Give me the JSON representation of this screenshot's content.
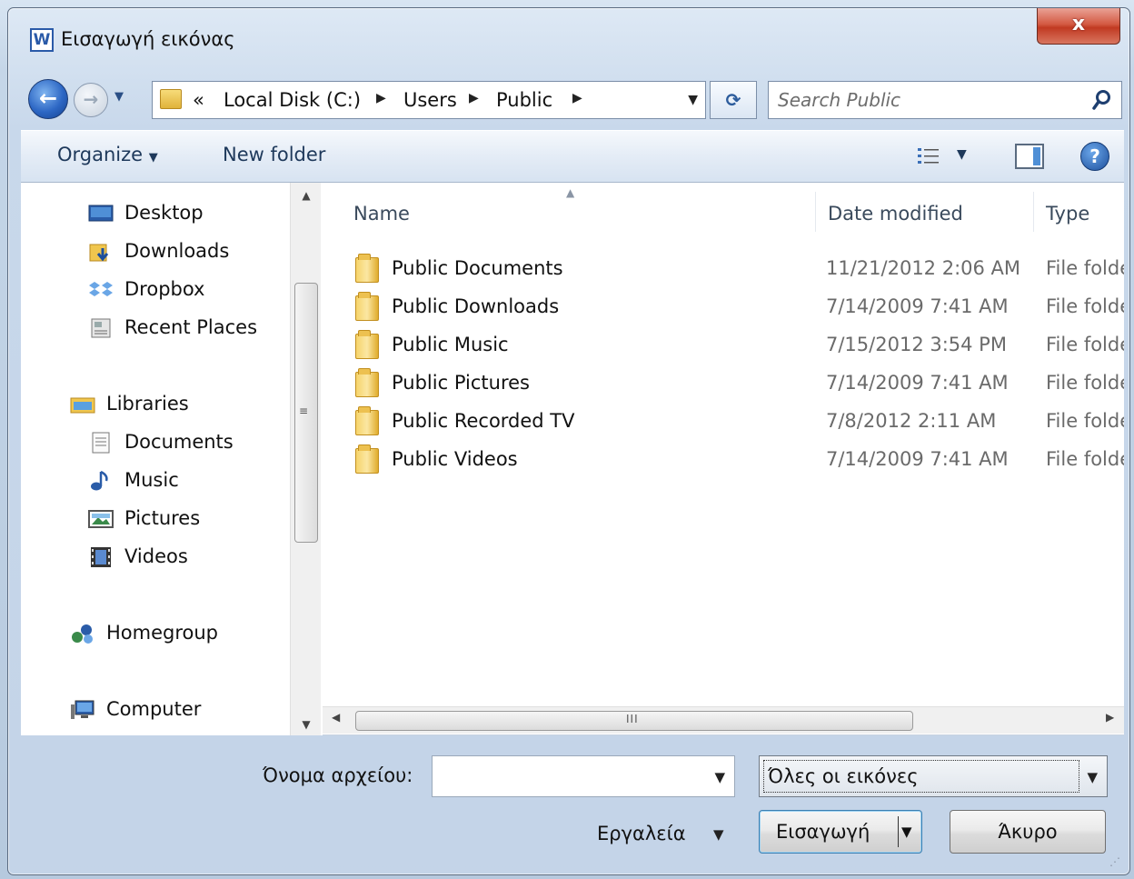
{
  "window": {
    "title": "Εισαγωγή εικόνας",
    "app_icon_letter": "W",
    "close_glyph": "x"
  },
  "nav": {
    "back_glyph": "←",
    "forward_glyph": "→",
    "breadcrumb_prefix": "«",
    "breadcrumbs": [
      "Local Disk (C:)",
      "Users",
      "Public"
    ],
    "search_placeholder": "Search Public",
    "refresh_glyph": "⟳"
  },
  "toolbar": {
    "organize": "Organize",
    "new_folder": "New folder",
    "help_glyph": "?"
  },
  "sidebar": {
    "items": [
      {
        "label": "Desktop",
        "icon": "desktop-icon"
      },
      {
        "label": "Downloads",
        "icon": "downloads-icon"
      },
      {
        "label": "Dropbox",
        "icon": "dropbox-icon"
      },
      {
        "label": "Recent Places",
        "icon": "recent-places-icon"
      },
      {
        "label": "Libraries",
        "icon": "libraries-icon"
      },
      {
        "label": "Documents",
        "icon": "documents-icon"
      },
      {
        "label": "Music",
        "icon": "music-icon"
      },
      {
        "label": "Pictures",
        "icon": "pictures-icon"
      },
      {
        "label": "Videos",
        "icon": "videos-icon"
      },
      {
        "label": "Homegroup",
        "icon": "homegroup-icon"
      },
      {
        "label": "Computer",
        "icon": "computer-icon"
      }
    ]
  },
  "files": {
    "columns": [
      "Name",
      "Date modified",
      "Type"
    ],
    "rows": [
      {
        "name": "Public Documents",
        "date": "11/21/2012 2:06 AM",
        "type": "File folder"
      },
      {
        "name": "Public Downloads",
        "date": "7/14/2009 7:41 AM",
        "type": "File folder"
      },
      {
        "name": "Public Music",
        "date": "7/15/2012 3:54 PM",
        "type": "File folder"
      },
      {
        "name": "Public Pictures",
        "date": "7/14/2009 7:41 AM",
        "type": "File folder"
      },
      {
        "name": "Public Recorded TV",
        "date": "7/8/2012 2:11 AM",
        "type": "File folder"
      },
      {
        "name": "Public Videos",
        "date": "7/14/2009 7:41 AM",
        "type": "File folder"
      }
    ]
  },
  "footer": {
    "filename_label": "Όνομα αρχείου:",
    "filename_value": "",
    "filetype_value": "Όλες οι εικόνες",
    "tools_label": "Εργαλεία",
    "insert_label": "Εισαγωγή",
    "cancel_label": "Άκυρο"
  },
  "colors": {
    "accent": "#2d67c4",
    "close": "#c13a22",
    "folder": "#f6d46b"
  }
}
